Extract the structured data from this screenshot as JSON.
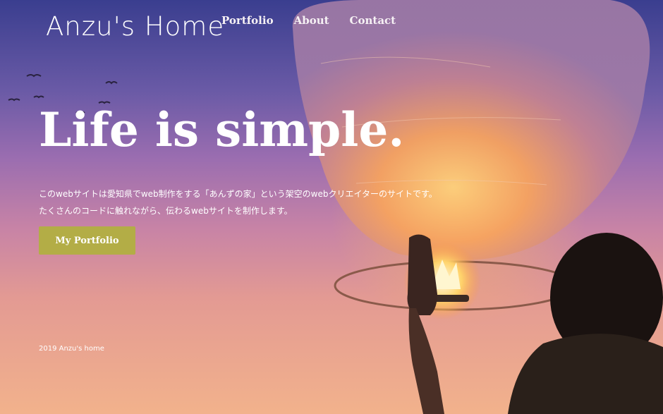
{
  "header": {
    "logo": "Anzu's Home",
    "nav": [
      "Portfolio",
      "About",
      "Contact"
    ]
  },
  "hero": {
    "headline": "Life is simple.",
    "intro_lines": [
      "このwebサイトは愛知県でweb制作をする「あんずの家」という架空のwebクリエイターのサイトです。",
      "たくさんのコードに触れながら、伝わるwebサイトを制作します。"
    ],
    "cta_label": "My Portfolio"
  },
  "footer": {
    "copyright": "2019 Anzu's home"
  },
  "colors": {
    "cta": "#b3ad46",
    "sky_top": "#3a3e8f",
    "sky_bottom": "#f2b28c"
  },
  "icons": {
    "background": "sky-lantern-photo"
  }
}
